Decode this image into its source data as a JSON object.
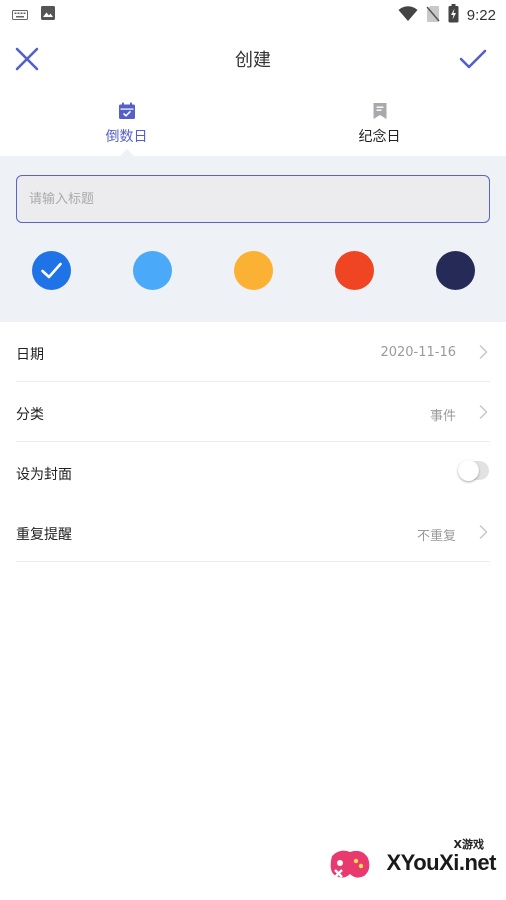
{
  "status_bar": {
    "time": "9:22",
    "left_icons": [
      "keyboard-icon",
      "image-icon"
    ],
    "right_icons": [
      "wifi-icon",
      "no-sim-icon",
      "battery-charging-icon"
    ]
  },
  "app_bar": {
    "title": "创建",
    "close_icon": "close-icon",
    "confirm_icon": "check-icon"
  },
  "tabs": [
    {
      "label": "倒数日",
      "icon": "calendar-check-icon",
      "active": true
    },
    {
      "label": "纪念日",
      "icon": "bookmark-icon",
      "active": false
    }
  ],
  "title_input": {
    "value": "",
    "placeholder": "请输入标题"
  },
  "colors": {
    "selected_index": 0,
    "swatches": [
      "#1f73e6",
      "#4aa9f8",
      "#fbb133",
      "#f04523",
      "#262a56"
    ]
  },
  "settings": [
    {
      "label": "日期",
      "value": "2020-11-16",
      "type": "link"
    },
    {
      "label": "分类",
      "value": "事件",
      "type": "link"
    },
    {
      "label": "设为封面",
      "value": "",
      "type": "toggle",
      "on": false
    },
    {
      "label": "重复提醒",
      "value": "不重复",
      "type": "link"
    }
  ],
  "accent_color": "#5460c8",
  "watermark": {
    "small_text": "X游戏",
    "big_text": "XYouXi.net"
  }
}
